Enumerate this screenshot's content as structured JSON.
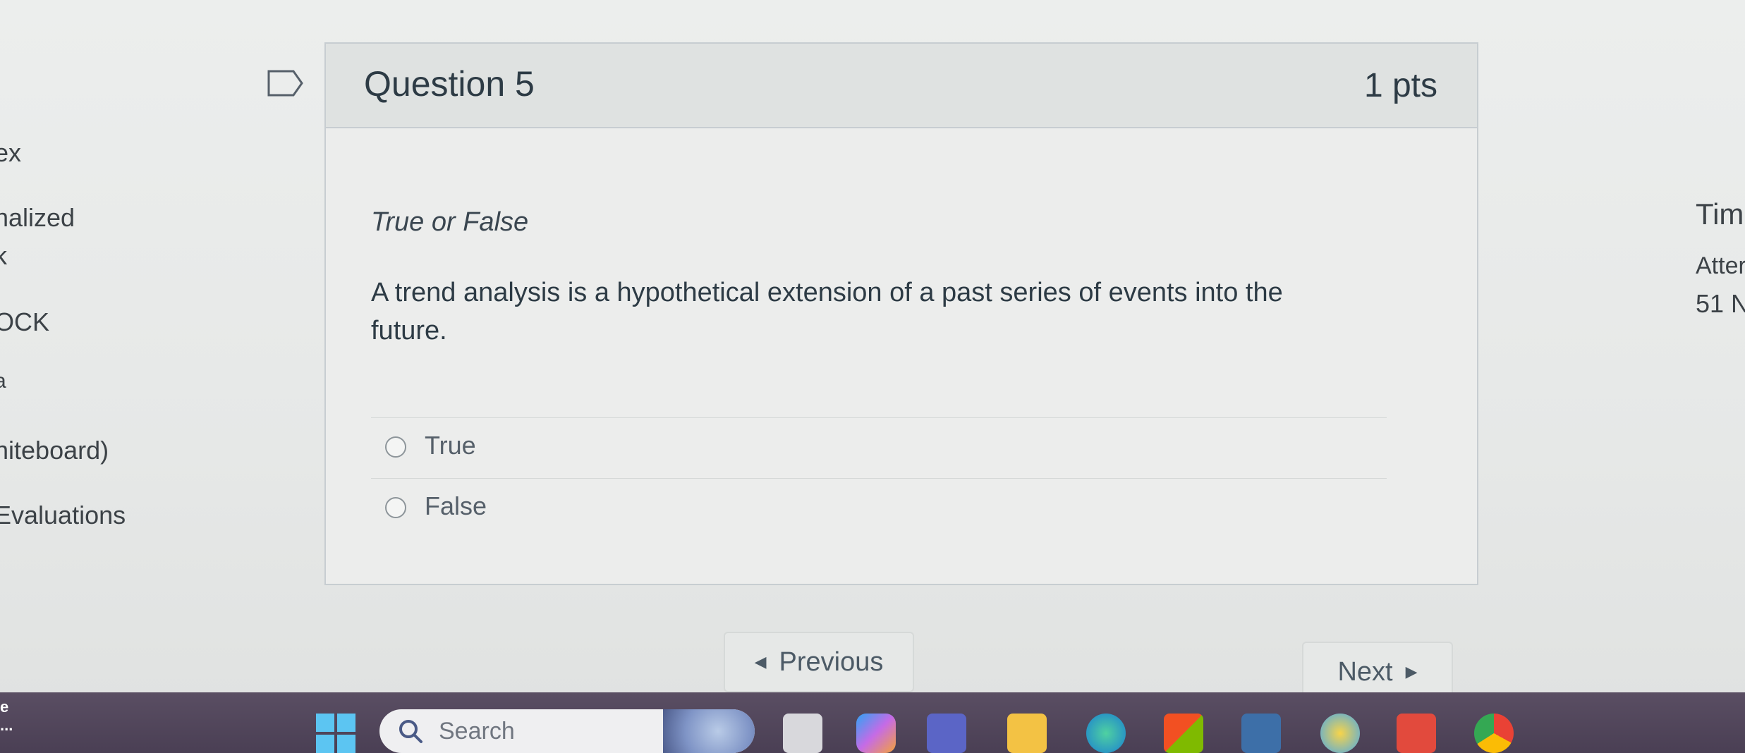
{
  "left_nav": {
    "items": [
      "ex",
      "nalized",
      "k",
      "OCK",
      "a",
      "hiteboard)",
      "Evaluations"
    ]
  },
  "right_info": {
    "line1": "Tim",
    "line2": "Atter",
    "line3": "51 N"
  },
  "question": {
    "title": "Question 5",
    "points": "1 pts",
    "type": "True or False",
    "text": "A trend analysis is a hypothetical extension of a past series of events into the future.",
    "answers": [
      {
        "label": "True",
        "selected": false
      },
      {
        "label": "False",
        "selected": false
      }
    ]
  },
  "navigation": {
    "previous_label": "Previous",
    "next_label": "Next"
  },
  "taskbar": {
    "search_placeholder": "Search",
    "left_badge": "e",
    "left_badge_sub": "..."
  },
  "icons": {
    "bookmark": "bookmark-flag-icon",
    "previous_arrow": "caret-left-icon",
    "next_arrow": "caret-right-icon",
    "start": "windows-start-icon",
    "search": "magnifier-icon",
    "taskbar_apps": [
      "task-view-icon",
      "copilot-icon",
      "teams-icon",
      "file-explorer-icon",
      "edge-icon",
      "store-icon",
      "mcgraw-hill-icon",
      "chrome-like-icon",
      "gmail-icon",
      "chrome-icon"
    ]
  },
  "colors": {
    "card_header_bg": "#dfe2e1",
    "text": "#2d3b45",
    "taskbar": "#4a3f54",
    "start_logo": "#5cc5f2"
  }
}
